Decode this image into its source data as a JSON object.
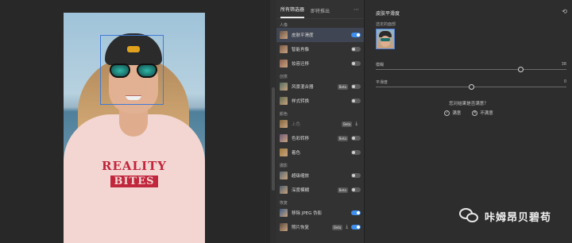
{
  "tabs": [
    {
      "label": "所有筛选器",
      "active": true
    },
    {
      "label": "即将推出",
      "active": false
    }
  ],
  "filters_panel": {
    "more_icon": "ellipsis-icon",
    "groups": [
      {
        "label": "人像",
        "items": [
          {
            "label": "皮肤平滑度",
            "toggle": true,
            "selected": true
          },
          {
            "label": "智能肖像",
            "toggle": false
          },
          {
            "label": "妆容迁移",
            "toggle": false
          }
        ]
      },
      {
        "label": "创意",
        "items": [
          {
            "label": "风景混合器",
            "badge": "Beta",
            "toggle": false
          },
          {
            "label": "样式转换",
            "toggle": false
          }
        ]
      },
      {
        "label": "颜色",
        "items": [
          {
            "label": "上色",
            "badge": "Beta",
            "disabled": true
          },
          {
            "label": "色彩转移",
            "badge": "Beta",
            "toggle": false
          },
          {
            "label": "着色",
            "toggle": false
          }
        ]
      },
      {
        "label": "摄影",
        "items": [
          {
            "label": "超级缩放",
            "toggle": false
          },
          {
            "label": "深度模糊",
            "badge": "Beta",
            "toggle": false
          }
        ]
      },
      {
        "label": "恢复",
        "items": [
          {
            "label": "移除 JPEG 伪影",
            "toggle": true
          },
          {
            "label": "照片恢复",
            "badge": "Beta",
            "toggle": true,
            "download": true
          }
        ]
      }
    ]
  },
  "settings": {
    "title": "皮肤平滑度",
    "selected_face_label": "选定的面部",
    "sliders": [
      {
        "label": "模糊",
        "value": "38",
        "level": 0.76
      },
      {
        "label": "平滑度",
        "value": "0",
        "level": 0.5
      }
    ],
    "question": "您对结果是否满意？",
    "answers": [
      {
        "label": "满意",
        "icon": "thumbs-up-icon"
      },
      {
        "label": "不满意",
        "icon": "thumbs-down-icon"
      }
    ],
    "reset_icon": "reset-icon"
  },
  "canvas": {
    "shirt_text_line1": "REALITY",
    "shirt_text_line2": "BITES"
  },
  "watermark": {
    "text": "咔姆昂贝碧苟"
  },
  "colors": {
    "accent": "#3d8ff0",
    "face_box": "#3f7ad6",
    "panel_bg": "#323232"
  }
}
